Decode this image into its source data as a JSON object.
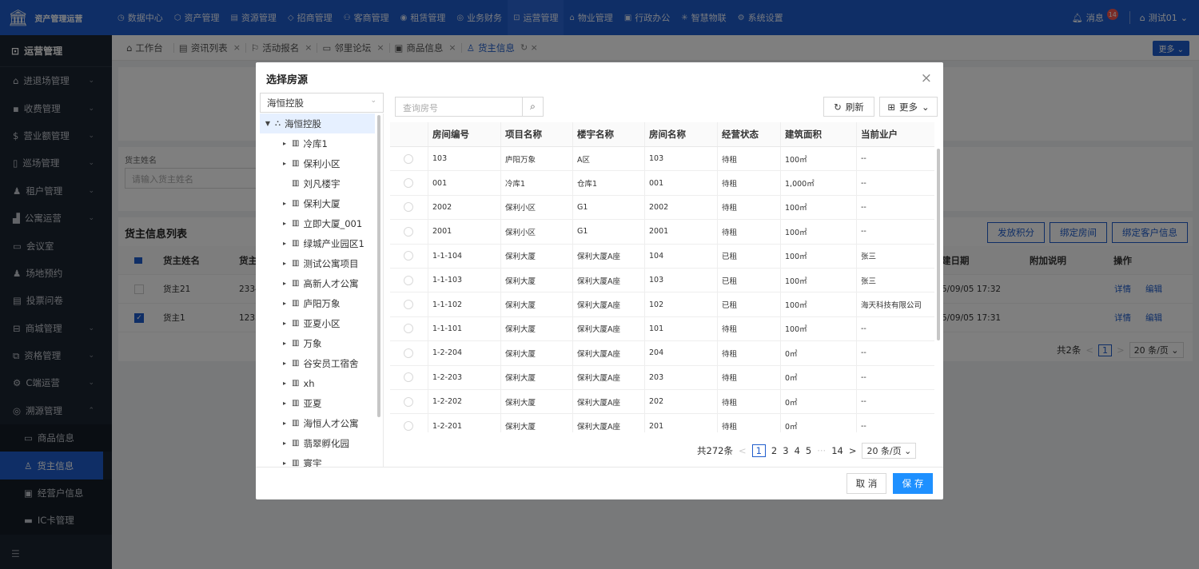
{
  "app": {
    "title": "资产管理运营"
  },
  "topnav": [
    {
      "label": "数据中心",
      "icon": "◷"
    },
    {
      "label": "资产管理",
      "icon": "⬡"
    },
    {
      "label": "资源管理",
      "icon": "▤"
    },
    {
      "label": "招商管理",
      "icon": "◇"
    },
    {
      "label": "客商管理",
      "icon": "⚇"
    },
    {
      "label": "租赁管理",
      "icon": "◉"
    },
    {
      "label": "业务财务",
      "icon": "◎"
    },
    {
      "label": "运营管理",
      "icon": "⊡"
    },
    {
      "label": "物业管理",
      "icon": "⌂"
    },
    {
      "label": "行政办公",
      "icon": "▣"
    },
    {
      "label": "智慧物联",
      "icon": "✳"
    },
    {
      "label": "系统设置",
      "icon": "⚙"
    }
  ],
  "topright": {
    "messages_label": "消息",
    "messages_count": "14",
    "user": "测试01"
  },
  "sidebar": {
    "header": "运营管理",
    "items": [
      {
        "label": "进退场管理",
        "icon": "⌂",
        "chev": "⌄"
      },
      {
        "label": "收费管理",
        "icon": "▪",
        "chev": "⌄"
      },
      {
        "label": "营业额管理",
        "icon": "$",
        "chev": "⌄"
      },
      {
        "label": "巡场管理",
        "icon": "▯",
        "chev": "⌄"
      },
      {
        "label": "租户管理",
        "icon": "♟",
        "chev": "⌄"
      },
      {
        "label": "公寓运营",
        "icon": "▟",
        "chev": "⌄"
      },
      {
        "label": "会议室",
        "icon": "▭",
        "chev": ""
      },
      {
        "label": "场地预约",
        "icon": "♟",
        "chev": ""
      },
      {
        "label": "投票问卷",
        "icon": "▤",
        "chev": ""
      },
      {
        "label": "商城管理",
        "icon": "⊟",
        "chev": "⌄"
      },
      {
        "label": "资格管理",
        "icon": "⧉",
        "chev": "⌄"
      },
      {
        "label": "C端运营",
        "icon": "⚙",
        "chev": "⌄"
      },
      {
        "label": "溯源管理",
        "icon": "◎",
        "chev": "⌃"
      }
    ],
    "subitems": [
      {
        "label": "商品信息",
        "icon": "▭"
      },
      {
        "label": "货主信息",
        "icon": "♙"
      },
      {
        "label": "经营户信息",
        "icon": "▣"
      },
      {
        "label": "IC卡管理",
        "icon": "▬"
      }
    ],
    "collapse_icon": "☰"
  },
  "tabs": [
    {
      "label": "工作台",
      "icon": "⌂",
      "close": ""
    },
    {
      "label": "资讯列表",
      "icon": "▤",
      "close": "×"
    },
    {
      "label": "活动报名",
      "icon": "⚐",
      "close": "×"
    },
    {
      "label": "邻里论坛",
      "icon": "▭",
      "close": "×"
    },
    {
      "label": "商品信息",
      "icon": "▣",
      "close": "×"
    },
    {
      "label": "货主信息",
      "icon": "♙",
      "close": "↻ ×"
    }
  ],
  "tab_more": "更多 ⌄",
  "filter": {
    "label": "货主姓名",
    "placeholder": "请输入货主姓名"
  },
  "list": {
    "title": "货主信息列表",
    "buttons": [
      "发放积分",
      "绑定房间",
      "绑定客户信息"
    ],
    "headers": [
      "货主姓名",
      "货主",
      "建日期",
      "附加说明",
      "操作"
    ],
    "rows": [
      {
        "name": "货主21",
        "col2": "2334",
        "date": "5/09/05 17:32",
        "checked": false
      },
      {
        "name": "货主1",
        "col2": "1233",
        "date": "5/09/05 17:31",
        "checked": true
      }
    ],
    "actions": [
      "详情",
      "编辑"
    ],
    "pager": {
      "total": "共2条",
      "page": "1",
      "size": "20 条/页 ⌄"
    }
  },
  "modal": {
    "title": "选择房源",
    "close_icon": "×",
    "tree_select": "海恒控股",
    "tree_root": "海恒控股",
    "tree_children": [
      {
        "label": "冷库1",
        "expandable": true
      },
      {
        "label": "保利小区",
        "expandable": true
      },
      {
        "label": "刘凡楼宇",
        "expandable": false
      },
      {
        "label": "保利大厦",
        "expandable": true
      },
      {
        "label": "立即大厦_001",
        "expandable": true
      },
      {
        "label": "绿城产业园区1",
        "expandable": true
      },
      {
        "label": "测试公寓项目",
        "expandable": true
      },
      {
        "label": "高新人才公寓",
        "expandable": true
      },
      {
        "label": "庐阳万象",
        "expandable": true
      },
      {
        "label": "亚夏小区",
        "expandable": true
      },
      {
        "label": "万象",
        "expandable": true
      },
      {
        "label": "谷安员工宿舍",
        "expandable": true
      },
      {
        "label": "xh",
        "expandable": true
      },
      {
        "label": "亚夏",
        "expandable": true
      },
      {
        "label": "海恒人才公寓",
        "expandable": true
      },
      {
        "label": "翡翠孵化园",
        "expandable": true
      },
      {
        "label": "寰宇",
        "expandable": true
      }
    ],
    "search_placeholder": "查询房号",
    "refresh_label": "刷新",
    "more_label": "更多",
    "columns": [
      "房间编号",
      "项目名称",
      "楼宇名称",
      "房间名称",
      "经营状态",
      "建筑面积",
      "当前业户"
    ],
    "rows": [
      [
        "103",
        "庐阳万象",
        "A区",
        "103",
        "待租",
        "100㎡",
        "--"
      ],
      [
        "001",
        "冷库1",
        "仓库1",
        "001",
        "待租",
        "1,000㎡",
        "--"
      ],
      [
        "2002",
        "保利小区",
        "G1",
        "2002",
        "待租",
        "100㎡",
        "--"
      ],
      [
        "2001",
        "保利小区",
        "G1",
        "2001",
        "待租",
        "100㎡",
        "--"
      ],
      [
        "1-1-104",
        "保利大厦",
        "保利大厦A座",
        "104",
        "已租",
        "100㎡",
        "张三"
      ],
      [
        "1-1-103",
        "保利大厦",
        "保利大厦A座",
        "103",
        "已租",
        "100㎡",
        "张三"
      ],
      [
        "1-1-102",
        "保利大厦",
        "保利大厦A座",
        "102",
        "已租",
        "100㎡",
        "海天科技有限公司"
      ],
      [
        "1-1-101",
        "保利大厦",
        "保利大厦A座",
        "101",
        "待租",
        "100㎡",
        "--"
      ],
      [
        "1-2-204",
        "保利大厦",
        "保利大厦A座",
        "204",
        "待租",
        "0㎡",
        "--"
      ],
      [
        "1-2-203",
        "保利大厦",
        "保利大厦A座",
        "203",
        "待租",
        "0㎡",
        "--"
      ],
      [
        "1-2-202",
        "保利大厦",
        "保利大厦A座",
        "202",
        "待租",
        "0㎡",
        "--"
      ],
      [
        "1-2-201",
        "保利大厦",
        "保利大厦A座",
        "201",
        "待租",
        "0㎡",
        "--"
      ]
    ],
    "pager": {
      "total": "共272条",
      "prev": "<",
      "pages": [
        "1",
        "2",
        "3",
        "4",
        "5",
        "···",
        "14"
      ],
      "next": ">",
      "size": "20 条/页 ⌄"
    },
    "cancel_label": "取 消",
    "save_label": "保 存"
  },
  "colors": {
    "primary": "#1f5dcc",
    "sidebar": "#1b2430",
    "save": "#1e90ff"
  }
}
